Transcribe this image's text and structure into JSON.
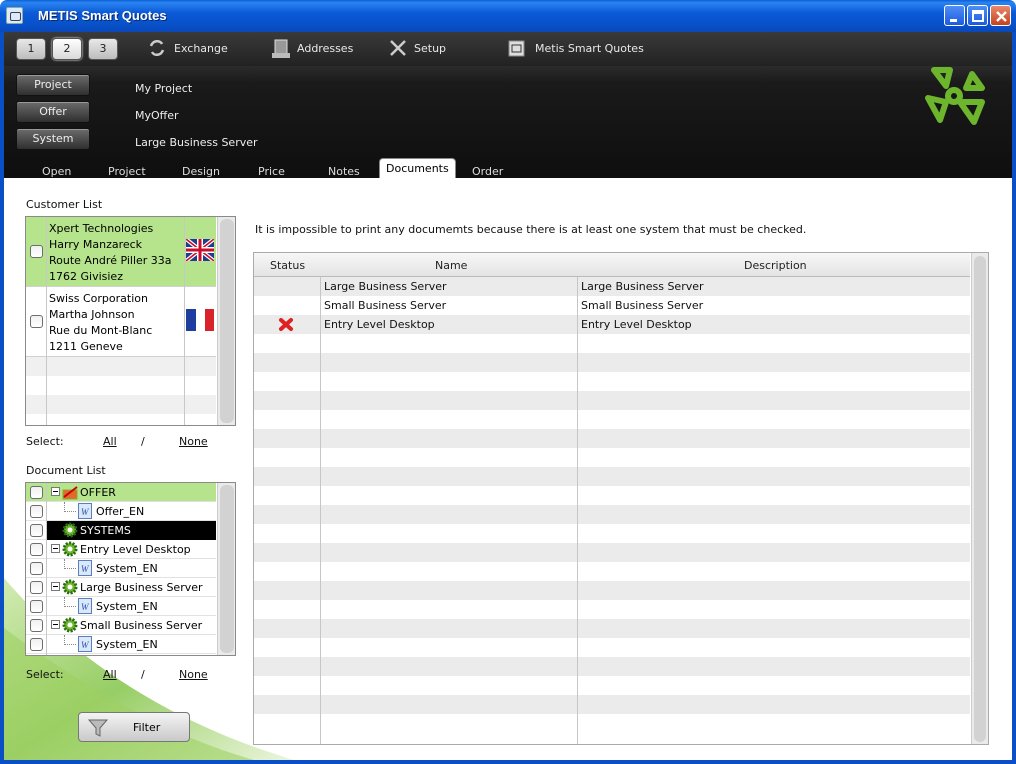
{
  "window": {
    "title": "METIS Smart Quotes"
  },
  "toolbar": {
    "pages": [
      "1",
      "2",
      "3"
    ],
    "exchange": "Exchange",
    "addresses": "Addresses",
    "setup": "Setup",
    "app_label": "Metis Smart Quotes"
  },
  "context": {
    "project_label": "Project",
    "project_value": "My Project",
    "offer_label": "Offer",
    "offer_value": "MyOffer",
    "system_label": "System",
    "system_value": "Large Business Server"
  },
  "tabs": [
    "Open",
    "Project",
    "Design",
    "Price",
    "Notes",
    "Documents",
    "Order"
  ],
  "active_tab": "Documents",
  "customer_list": {
    "title": "Customer List",
    "customers": [
      {
        "lines": [
          "Xpert Technologies",
          "Harry Manzareck",
          "Route André Piller 33a",
          "1762 Givisiez"
        ],
        "flag": "uk-flag"
      },
      {
        "lines": [
          "Swiss Corporation",
          "Martha Johnson",
          "Rue du Mont-Blanc",
          "1211 Geneve"
        ],
        "flag": "france-flag"
      }
    ],
    "select_label": "Select:",
    "all": "All",
    "sep": "/",
    "none": "None"
  },
  "document_list": {
    "title": "Document List",
    "items": [
      {
        "label": "OFFER",
        "level": 0,
        "icon": "offer-icon",
        "expander": true,
        "style": "green"
      },
      {
        "label": "Offer_EN",
        "level": 1,
        "icon": "word-doc-icon",
        "expander": false,
        "style": ""
      },
      {
        "label": "SYSTEMS",
        "level": 0,
        "icon": "gear-icon",
        "expander": false,
        "style": "black"
      },
      {
        "label": "Entry Level Desktop",
        "level": 0,
        "icon": "gear-icon",
        "expander": true,
        "style": ""
      },
      {
        "label": "System_EN",
        "level": 1,
        "icon": "word-doc-icon",
        "expander": false,
        "style": ""
      },
      {
        "label": "Large Business Server",
        "level": 0,
        "icon": "gear-icon",
        "expander": true,
        "style": ""
      },
      {
        "label": "System_EN",
        "level": 1,
        "icon": "word-doc-icon",
        "expander": false,
        "style": ""
      },
      {
        "label": "Small Business Server",
        "level": 0,
        "icon": "gear-icon",
        "expander": true,
        "style": ""
      },
      {
        "label": "System_EN",
        "level": 1,
        "icon": "word-doc-icon",
        "expander": false,
        "style": ""
      }
    ],
    "select_label": "Select:",
    "all": "All",
    "sep": "/",
    "none": "None"
  },
  "filter_button": "Filter",
  "message": "It is impossible to print any documemts because there is at least one system that must be checked.",
  "systems_table": {
    "headers": [
      "Status",
      "Name",
      "Description"
    ],
    "rows": [
      {
        "status": "",
        "name": "Large Business Server",
        "description": "Large Business Server"
      },
      {
        "status": "",
        "name": "Small Business Server",
        "description": "Small Business Server"
      },
      {
        "status": "error-x-icon",
        "name": "Entry Level Desktop",
        "description": "Entry Level Desktop"
      }
    ]
  },
  "colors": {
    "selected_row": "#b5e48c",
    "title_bar": "#0a5fd6",
    "header_bg": "#1a1a1a",
    "logo_green": "#6cb52d"
  }
}
